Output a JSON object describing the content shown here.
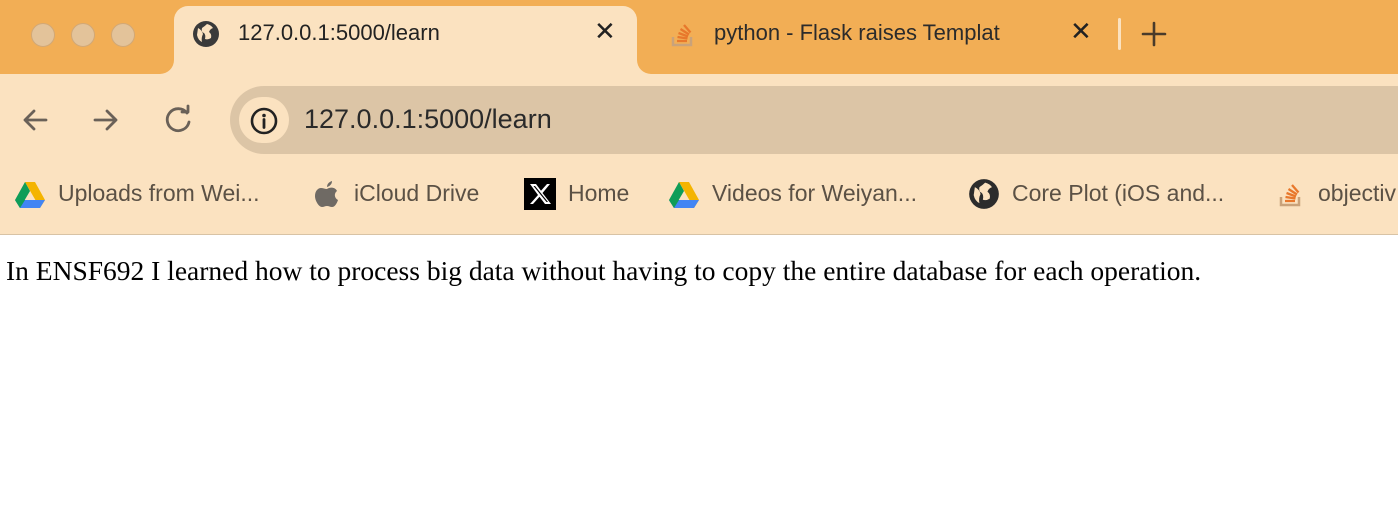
{
  "tabs": [
    {
      "title": "127.0.0.1:5000/learn",
      "active": true
    },
    {
      "title": "python - Flask raises Templat",
      "active": false
    }
  ],
  "address_bar": {
    "url": "127.0.0.1:5000/learn"
  },
  "bookmarks": [
    {
      "label": "Uploads from Wei...",
      "icon": "google-drive-icon"
    },
    {
      "label": "iCloud Drive",
      "icon": "apple-icon"
    },
    {
      "label": "Home",
      "icon": "x-logo-icon"
    },
    {
      "label": "Videos for Weiyan...",
      "icon": "google-drive-icon"
    },
    {
      "label": "Core Plot (iOS and...",
      "icon": "globe-icon"
    },
    {
      "label": "objectiv",
      "icon": "stackoverflow-icon"
    }
  ],
  "page": {
    "body_text": "In ENSF692 I learned how to process big data without having to copy the entire database for each operation."
  },
  "colors": {
    "tabstrip": "#f2ae55",
    "toolbar": "#fbe2c0",
    "omnibox": "#dcc5a6"
  }
}
